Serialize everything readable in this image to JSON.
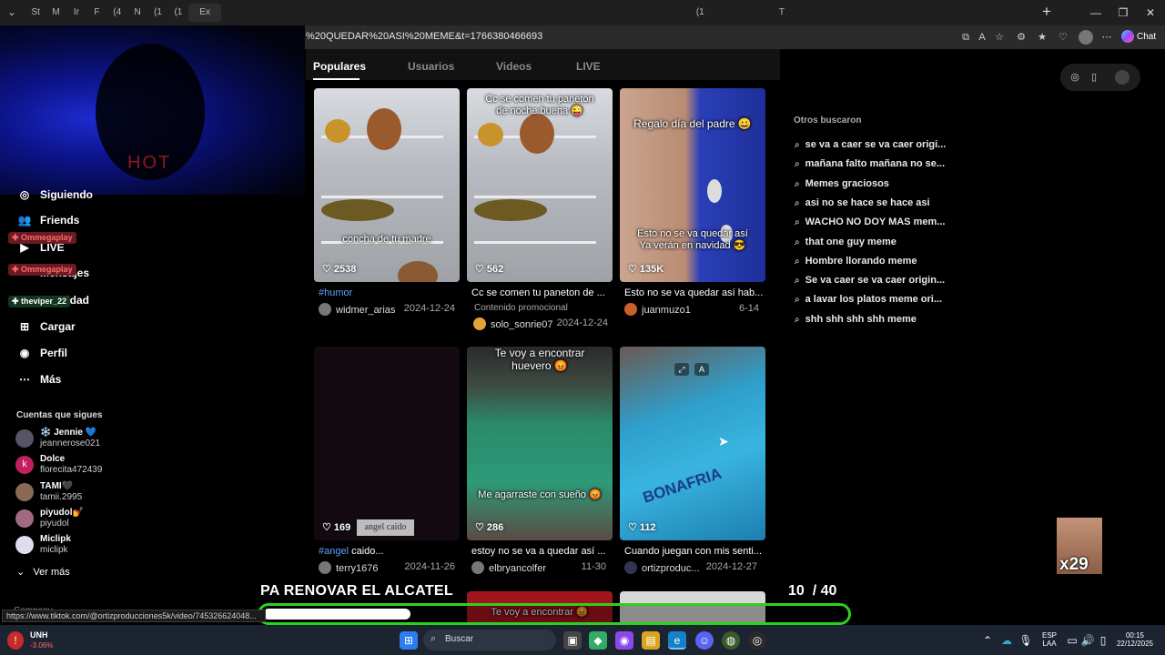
{
  "browser": {
    "tab_labels": [
      "St",
      "M",
      "Ir",
      "F",
      "(4",
      "N",
      "(1",
      "(1",
      "Ex",
      "",
      "",
      "",
      "",
      "",
      "",
      "",
      "",
      "",
      "",
      "",
      "",
      "",
      "",
      "",
      "",
      "",
      "",
      "",
      "",
      "",
      "",
      "",
      "(1",
      "",
      "",
      "",
      "T",
      "",
      "",
      "",
      "",
      "",
      "",
      "",
      "",
      "",
      "",
      "",
      ""
    ],
    "url": "%20QUEDAR%20ASI%20MEME&t=1766380466693",
    "chat_label": "Chat"
  },
  "sidebar": {
    "items": [
      {
        "label": "Siguiendo",
        "icon": "following-icon"
      },
      {
        "label": "Friends",
        "icon": "friends-icon"
      },
      {
        "label": "LIVE",
        "icon": "live-icon"
      },
      {
        "label": "Mensajes",
        "icon": "messages-icon"
      },
      {
        "label": "Actividad",
        "icon": "activity-icon"
      },
      {
        "label": "Cargar",
        "icon": "upload-icon"
      },
      {
        "label": "Perfil",
        "icon": "profile-icon"
      },
      {
        "label": "Más",
        "icon": "more-icon"
      }
    ],
    "following_title": "Cuentas que sigues",
    "following": [
      {
        "name": "❄️ Jennie 💙",
        "user": "jeannerose021",
        "initial": ""
      },
      {
        "name": "Dolce",
        "user": "florecita472439",
        "initial": "k"
      },
      {
        "name": "TAMI🖤",
        "user": "tamii.2995",
        "initial": ""
      },
      {
        "name": "piyudol💅",
        "user": "piyudol",
        "initial": ""
      },
      {
        "name": "Miclipk",
        "user": "miclipk",
        "initial": ""
      }
    ],
    "see_more": "Ver más",
    "company": "Company"
  },
  "chat_badges": [
    "Ommegaplay",
    "Ommegaplay",
    "theviper_22"
  ],
  "feed": {
    "tabs": [
      "Populares",
      "Usuarios",
      "Videos",
      "LIVE"
    ],
    "active_tab": 0,
    "cards": [
      {
        "overlay_top": "",
        "overlay_bottom": "concha de tu madre",
        "likes": "2538",
        "title_tag": "#humor",
        "title": "",
        "user": "widmer_arias",
        "date": "2024-12-24",
        "promo": "",
        "style": "fridge"
      },
      {
        "overlay_top": "Cc se comen tu paneton de noche buena 😜",
        "overlay_bottom": "",
        "likes": "562",
        "title_tag": "",
        "title": "Cc se comen tu paneton de ...",
        "user": "solo_sonrie07",
        "date": "2024-12-24",
        "promo": "Contenido promocional",
        "style": "fridge"
      },
      {
        "overlay_top": "Regalo día del padre 😀",
        "overlay_bottom": "Esto no se va quedar así Ya verán en navidad 😎",
        "likes": "135K",
        "title_tag": "",
        "title": "Esto no se va quedar así hab...",
        "user": "juanmuzo1",
        "date": "6-14",
        "promo": "",
        "style": "gift"
      },
      {
        "overlay_top": "",
        "overlay_bottom": "",
        "likes": "169",
        "caption_box": "angel caido",
        "title_tag": "#angel",
        "title": " caido...",
        "user": "terry1676",
        "date": "2024-11-26",
        "promo": "",
        "style": "dark"
      },
      {
        "overlay_top": "Te voy a encontrar huevero 😡",
        "overlay_bottom": "Me agarraste con sueño 😡",
        "likes": "286",
        "title_tag": "",
        "title": "estoy no se va a quedar así ...",
        "user": "elbryancolfer",
        "date": "11-30",
        "promo": "",
        "style": "eggs"
      },
      {
        "overlay_top": "",
        "overlay_bottom": "",
        "likes": "112",
        "title_tag": "",
        "title": "Cuando juegan con mis senti...",
        "user": "ortizproduc...",
        "date": "2024-12-27",
        "promo": "",
        "style": "box"
      }
    ]
  },
  "suggestions": {
    "title": "Otros buscaron",
    "items": [
      "se va a caer se va caer origi...",
      "mañana falto mañana no se...",
      "Memes graciosos",
      "asi no se hace se hace asi",
      "WACHO NO DOY MAS mem...",
      "that one guy meme",
      "Hombre llorando meme",
      "Se va caer se va caer origin...",
      "a lavar los platos meme ori...",
      "shh shh shh shh meme"
    ]
  },
  "stream": {
    "goal_text": "PA RENOVAR EL ALCATEL",
    "goal_current": "10",
    "goal_total": "/ 40",
    "goal_progress": 0.25,
    "multiplier": "x29",
    "hover_url": "https://www.tiktok.com/@ortizproducciones5k/video/745326624048...",
    "bottom_caption": "Te voy a encontrar 😡"
  },
  "taskbar": {
    "stock_name": "UNH",
    "stock_change": "-3.06%",
    "search_placeholder": "Buscar",
    "lang_top": "ESP",
    "lang_bottom": "LAA",
    "time": "00:15",
    "date": "22/12/2025"
  },
  "colors": {
    "accent_link": "#5ea0ff",
    "goal_border": "#2cd11e",
    "background": "#000000"
  }
}
